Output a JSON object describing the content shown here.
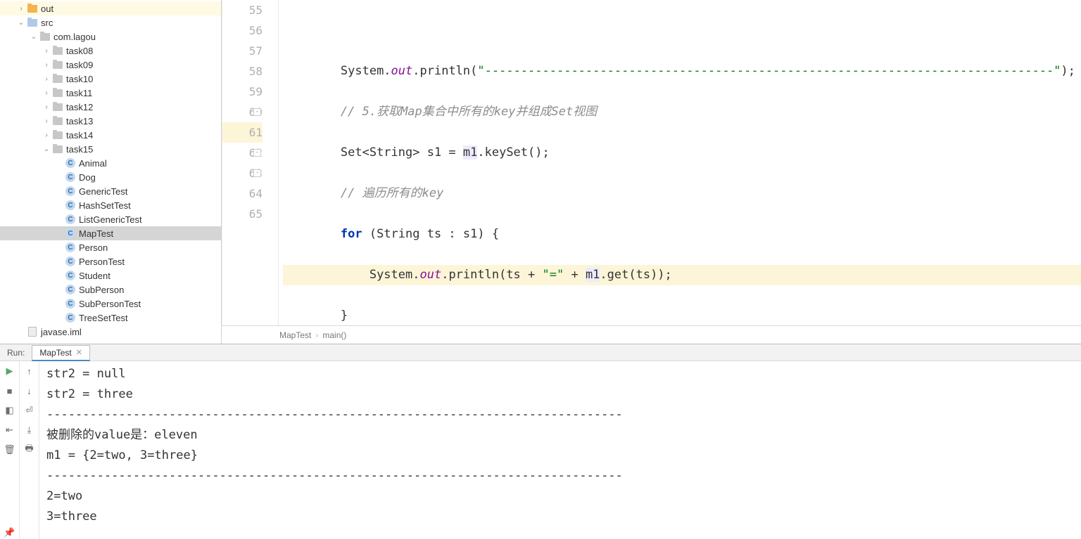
{
  "tree": {
    "out": "out",
    "src": "src",
    "pkg": "com.lagou",
    "tasks": [
      "task08",
      "task09",
      "task10",
      "task11",
      "task12",
      "task13",
      "task14"
    ],
    "task15": "task15",
    "classes": [
      "Animal",
      "Dog",
      "GenericTest",
      "HashSetTest",
      "ListGenericTest",
      "MapTest",
      "Person",
      "PersonTest",
      "Student",
      "SubPerson",
      "SubPersonTest",
      "TreeSetTest"
    ],
    "iml": "javase.iml",
    "selected": "MapTest"
  },
  "gutter": [
    "55",
    "56",
    "57",
    "58",
    "59",
    "60",
    "61",
    "62",
    "63",
    "64",
    "65"
  ],
  "code": {
    "l56_a": "System.",
    "l56_out": "out",
    "l56_b": ".println(",
    "l56_str": "\"-------------------------------------------------------------------------------\"",
    "l56_c": ");",
    "l57": "// 5.获取Map集合中所有的key并组成Set视图",
    "l58_a": "Set<String> s1 = ",
    "l58_m1": "m1",
    "l58_b": ".keySet();",
    "l59": "// 遍历所有的key",
    "l60_for": "for",
    "l60_a": " (String ts : s1) {",
    "l61_a": "System.",
    "l61_out": "out",
    "l61_b": ".println(ts + ",
    "l61_str": "\"=\"",
    "l61_c": " + ",
    "l61_m1": "m1",
    "l61_d": ".get(ts));",
    "l62": "}",
    "l63": "}",
    "l64": "}"
  },
  "breadcrumb": {
    "cls": "MapTest",
    "method": "main()"
  },
  "run": {
    "label": "Run:",
    "tab": "MapTest",
    "output": "str2 = null\nstr2 = three\n--------------------------------------------------------------------------------\n被删除的value是：eleven\nm1 = {2=two, 3=three}\n--------------------------------------------------------------------------------\n2=two\n3=three"
  }
}
